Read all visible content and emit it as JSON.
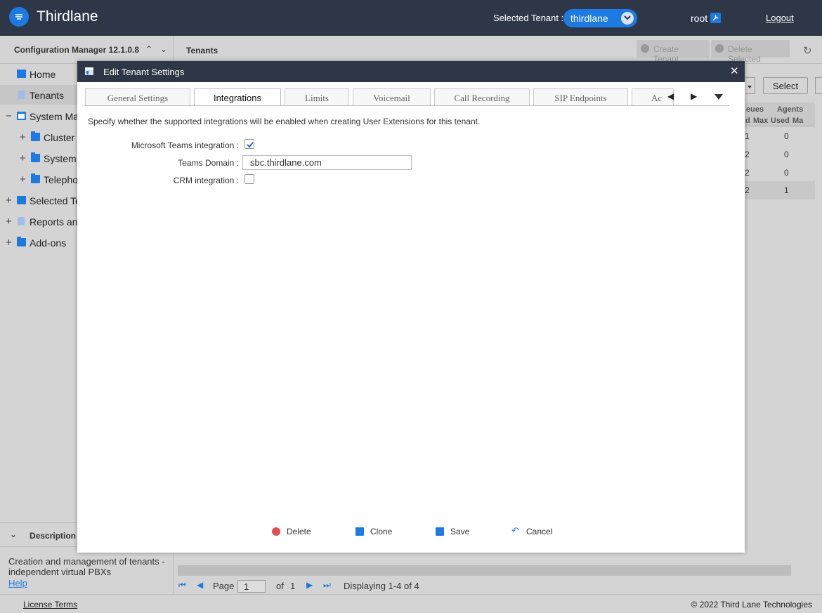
{
  "header": {
    "brand": "Thirdlane",
    "selected_tenant_label": "Selected Tenant :",
    "selected_tenant_value": "thirdlane",
    "user": "root",
    "logout": "Logout"
  },
  "sidebar": {
    "title": "Configuration Manager 12.1.0.8",
    "items": [
      {
        "label": "Home",
        "expander": ""
      },
      {
        "label": "Tenants",
        "expander": ""
      },
      {
        "label": "System Mar",
        "expander": "−"
      },
      {
        "label": "Cluster M",
        "expander": "+"
      },
      {
        "label": "System S",
        "expander": "+"
      },
      {
        "label": "Telephor",
        "expander": "+"
      },
      {
        "label": "Selected Ter",
        "expander": "+"
      },
      {
        "label": "Reports and",
        "expander": "+"
      },
      {
        "label": "Add-ons",
        "expander": "+"
      }
    ],
    "description_title": "Description",
    "description_text": "Creation and management of tenants - independent virtual PBXs",
    "description_help": "Help"
  },
  "main": {
    "title": "Tenants",
    "create_tenant": "Create Tenant",
    "delete_selected": "Delete Selected",
    "select_button": "Select",
    "grid": {
      "group_queues": "eues",
      "group_agents": "Agents",
      "sub_headers": [
        "d",
        "Max",
        "Used",
        "Ma"
      ],
      "rows": [
        [
          "1",
          "0"
        ],
        [
          "2",
          "0"
        ],
        [
          "2",
          "0"
        ],
        [
          "2",
          "1"
        ]
      ]
    },
    "pager": {
      "page_label": "Page",
      "page_value": "1",
      "of_label": "of",
      "of_value": "1",
      "displaying": "Displaying 1-4 of 4"
    }
  },
  "footer": {
    "license": "License Terms",
    "copyright": "© 2022 Third Lane Technologies"
  },
  "modal": {
    "title": "Edit Tenant Settings",
    "tabs": [
      "General Settings",
      "Integrations",
      "Limits",
      "Voicemail",
      "Call Recording",
      "SIP Endpoints",
      "Ac"
    ],
    "intro": "Specify whether the supported integrations will be enabled when creating User Extensions for this tenant.",
    "fields": {
      "teams_label": "Microsoft Teams integration :",
      "teams_checked": true,
      "domain_label": "Teams Domain :",
      "domain_value": "sbc.thirdlane.com",
      "crm_label": "CRM integration :",
      "crm_checked": false
    },
    "buttons": {
      "delete": "Delete",
      "clone": "Clone",
      "save": "Save",
      "cancel": "Cancel"
    }
  },
  "colors": {
    "header_bg": "#2d3747",
    "accent": "#1e7ae3",
    "panel_bg": "#d4d4d4",
    "delete_red": "#e05050"
  }
}
